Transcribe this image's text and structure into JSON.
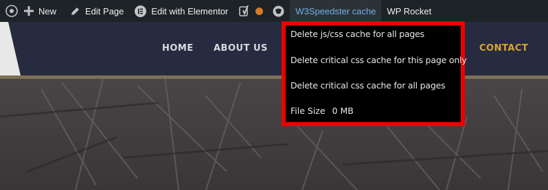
{
  "adminbar": {
    "new_label": "New",
    "edit_page_label": "Edit Page",
    "elementor_label": "Edit with Elementor",
    "speedster_label": "W3Speedster cache",
    "rocket_label": "WP Rocket"
  },
  "nav": {
    "items": [
      "HOME",
      "ABOUT US",
      "CONTACT"
    ]
  },
  "dropdown": {
    "items": [
      "Delete js/css cache for all pages",
      "Delete critical css cache for this page only",
      "Delete critical css cache for all pages"
    ],
    "file_size_label": "File Size",
    "file_size_value": "0 MB"
  },
  "colors": {
    "admin_bg": "#1d2327",
    "active_link": "#72aee6",
    "header_bg": "#262b3f",
    "contact": "#d9a730",
    "highlight_border": "#ee0000"
  }
}
